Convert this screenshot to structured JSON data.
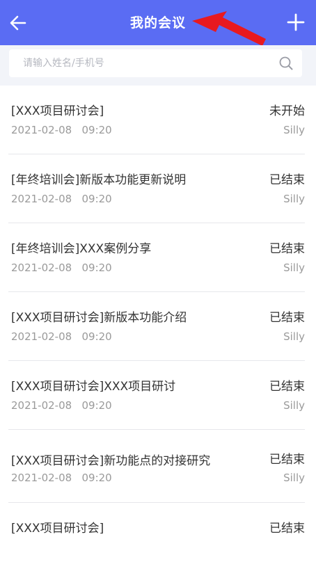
{
  "header": {
    "title": "我的会议",
    "back_icon": "back-arrow-icon",
    "add_icon": "plus-icon",
    "color": "#5A6CF3"
  },
  "annotation": {
    "icon": "red-arrow-pointer",
    "color": "#E8191F"
  },
  "search": {
    "placeholder": "请输入姓名/手机号",
    "value": "",
    "icon": "search-icon"
  },
  "meetings": [
    {
      "title": "[XXX项目研讨会]",
      "date": "2021-02-08",
      "time": "09:20",
      "status": "未开始",
      "owner": "Silly"
    },
    {
      "title": "[年终培训会]新版本功能更新说明",
      "date": "2021-02-08",
      "time": "09:20",
      "status": "已结束",
      "owner": "Silly"
    },
    {
      "title": "[年终培训会]XXX案例分享",
      "date": "2021-02-08",
      "time": "09:20",
      "status": "已结束",
      "owner": "Silly"
    },
    {
      "title": "[XXX项目研讨会]新版本功能介绍",
      "date": "2021-02-08",
      "time": "09:20",
      "status": "已结束",
      "owner": "Silly"
    },
    {
      "title": "[XXX项目研讨会]XXX项目研讨",
      "date": "2021-02-08",
      "time": "09:20",
      "status": "已结束",
      "owner": "Silly"
    },
    {
      "title": "[XXX项目研讨会]新功能点的对接研究",
      "date": "2021-02-08",
      "time": "09:20",
      "status": "已结束",
      "owner": "Silly"
    },
    {
      "title": "[XXX项目研讨会]",
      "date": "",
      "time": "",
      "status": "已结束",
      "owner": ""
    }
  ]
}
